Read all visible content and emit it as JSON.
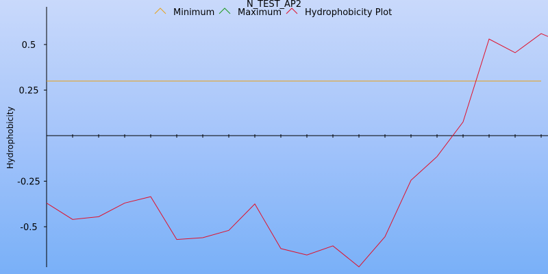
{
  "chart_data": {
    "type": "line",
    "title": "N_TEST_AP2",
    "xlabel": "",
    "ylabel": "Hydrophobicity",
    "ylim": [
      -0.72,
      0.7
    ],
    "yticks": [
      0.5,
      0.25,
      -0.25,
      -0.5
    ],
    "ytick_labels": [
      "0.5",
      "0.25",
      "-0.25",
      "-0.5"
    ],
    "grid": false,
    "legend_position": "top",
    "legend": [
      {
        "name": "Minimum",
        "color": "#e8a21a"
      },
      {
        "name": "Maximum",
        "color": "#1e9a1e"
      },
      {
        "name": "Hydrophobicity Plot",
        "color": "#e0102a"
      }
    ],
    "series": [
      {
        "name": "Minimum",
        "color": "#e8a21a",
        "constant": 0.3
      },
      {
        "name": "Hydrophobicity Plot",
        "color": "#e0102a",
        "x": [
          1,
          2,
          3,
          4,
          5,
          6,
          7,
          8,
          9,
          10,
          11,
          12,
          13,
          14,
          15,
          16,
          17,
          18,
          19,
          20,
          21
        ],
        "values": [
          -0.37,
          -0.46,
          -0.445,
          -0.37,
          -0.335,
          -0.57,
          -0.56,
          -0.52,
          -0.375,
          -0.62,
          -0.655,
          -0.605,
          -0.72,
          -0.555,
          -0.245,
          -0.115,
          0.075,
          0.53,
          0.455,
          0.56,
          0.5
        ]
      }
    ]
  }
}
